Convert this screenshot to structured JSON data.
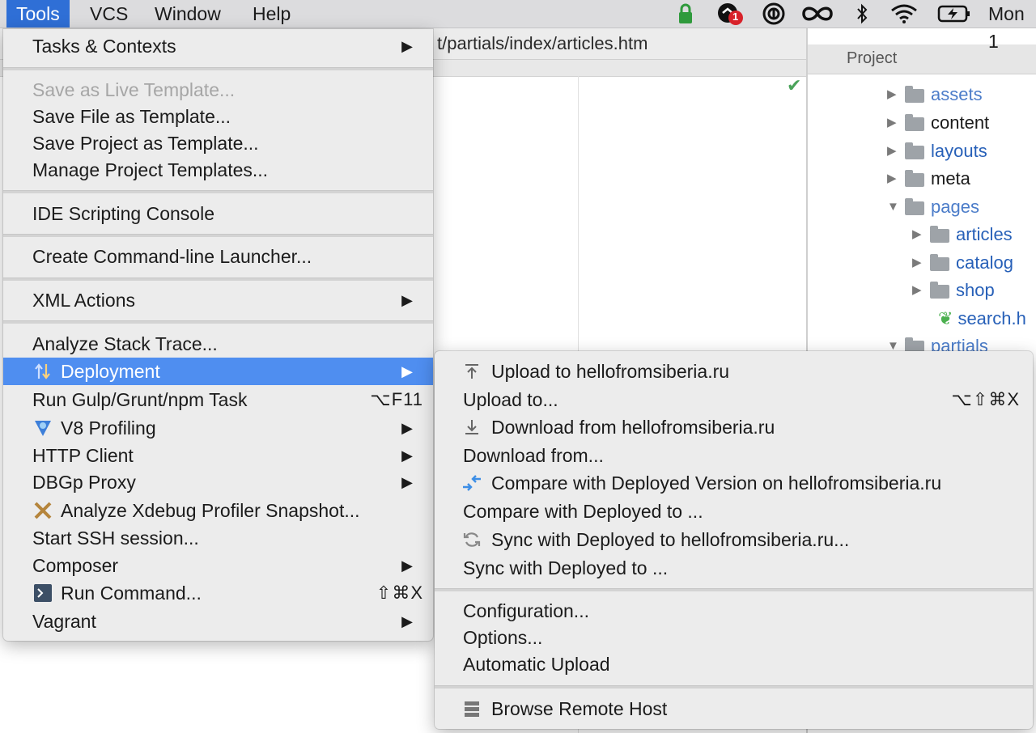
{
  "menubar": {
    "items": [
      "Tools",
      "VCS",
      "Window",
      "Help"
    ],
    "badge_count": "1",
    "clock": "Mon 1"
  },
  "editor": {
    "path": "t/partials/index/articles.htm"
  },
  "project": {
    "header": "Project",
    "tree": [
      {
        "label": "assets",
        "expanded": false
      },
      {
        "label": "content",
        "expanded": false
      },
      {
        "label": "layouts",
        "expanded": false
      },
      {
        "label": "meta",
        "expanded": false
      },
      {
        "label": "pages",
        "expanded": true
      },
      {
        "label": "articles",
        "expanded": false
      },
      {
        "label": "catalog",
        "expanded": false
      },
      {
        "label": "shop",
        "expanded": false
      },
      {
        "label": "search.h",
        "expanded": false
      },
      {
        "label": "partials",
        "expanded": true
      }
    ]
  },
  "tools_menu": {
    "items": [
      {
        "label": "Tasks & Contexts",
        "submenu": true
      },
      {
        "label": "Save as Live Template...",
        "disabled": true
      },
      {
        "label": "Save File as Template..."
      },
      {
        "label": "Save Project as Template..."
      },
      {
        "label": "Manage Project Templates..."
      },
      {
        "label": "IDE Scripting Console"
      },
      {
        "label": "Create Command-line Launcher..."
      },
      {
        "label": "XML Actions",
        "submenu": true
      },
      {
        "label": "Analyze Stack Trace..."
      },
      {
        "label": "Deployment",
        "submenu": true,
        "highlighted": true,
        "icon": "deployment-arrows-icon"
      },
      {
        "label": "Run Gulp/Grunt/npm Task",
        "shortcut": "⌥F11"
      },
      {
        "label": "V8 Profiling",
        "submenu": true,
        "icon": "v8-shield-icon"
      },
      {
        "label": "HTTP Client",
        "submenu": true
      },
      {
        "label": "DBGp Proxy",
        "submenu": true
      },
      {
        "label": "Analyze Xdebug Profiler Snapshot...",
        "icon": "xdebug-icon"
      },
      {
        "label": "Start SSH session..."
      },
      {
        "label": "Composer",
        "submenu": true
      },
      {
        "label": "Run Command...",
        "shortcut": "⇧⌘X",
        "icon": "terminal-icon"
      },
      {
        "label": "Vagrant",
        "submenu": true
      }
    ]
  },
  "deployment_menu": {
    "items": [
      {
        "label": "Upload to hellofromsiberia.ru",
        "icon": "upload-icon"
      },
      {
        "label": "Upload to...",
        "shortcut": "⌥⇧⌘X"
      },
      {
        "label": "Download from hellofromsiberia.ru",
        "icon": "download-icon"
      },
      {
        "label": "Download from..."
      },
      {
        "label": "Compare with Deployed Version on hellofromsiberia.ru",
        "icon": "compare-icon"
      },
      {
        "label": "Compare with Deployed to ..."
      },
      {
        "label": "Sync with Deployed to hellofromsiberia.ru...",
        "icon": "sync-icon"
      },
      {
        "label": "Sync with Deployed to ..."
      },
      {
        "label": "Configuration..."
      },
      {
        "label": "Options..."
      },
      {
        "label": "Automatic Upload"
      },
      {
        "label": "Browse Remote Host",
        "icon": "remote-host-icon"
      }
    ]
  },
  "colors": {
    "highlight": "#4f8ef0",
    "menubar_active": "#2f6fd6",
    "link_blue": "#2760b8"
  }
}
